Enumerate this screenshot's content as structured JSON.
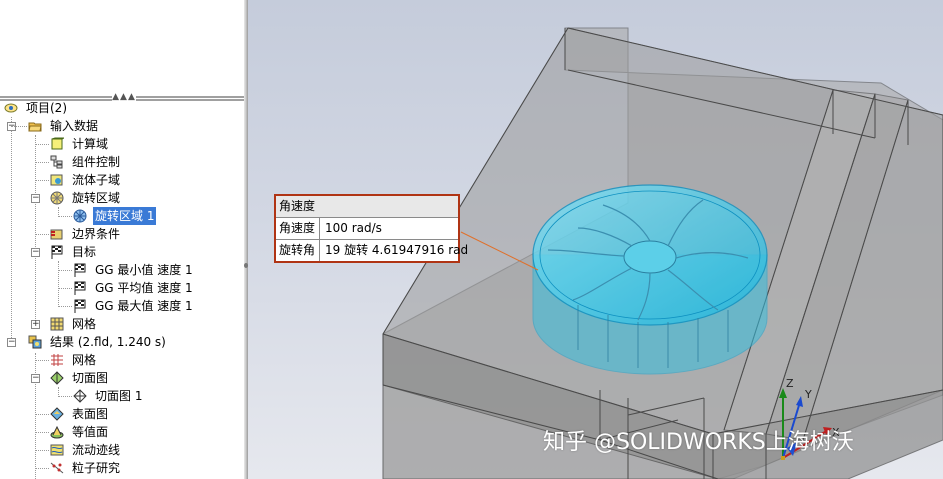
{
  "tree": {
    "items": [
      {
        "label": "项目(2)",
        "icon": "project-icon"
      },
      {
        "label": "输入数据",
        "icon": "folder-open-icon"
      },
      {
        "label": "计算域",
        "icon": "computational-domain-icon"
      },
      {
        "label": "组件控制",
        "icon": "component-control-icon"
      },
      {
        "label": "流体子域",
        "icon": "fluid-subdomain-icon"
      },
      {
        "label": "旋转区域",
        "icon": "rotating-region-icon"
      },
      {
        "label": "旋转区域 1",
        "icon": "rotating-region-icon"
      },
      {
        "label": "边界条件",
        "icon": "boundary-condition-icon"
      },
      {
        "label": "目标",
        "icon": "goals-icon"
      },
      {
        "label": "GG 最小值 速度 1",
        "icon": "goal-flag-icon"
      },
      {
        "label": "GG 平均值 速度 1",
        "icon": "goal-flag-icon"
      },
      {
        "label": "GG 最大值 速度 1",
        "icon": "goal-flag-icon"
      },
      {
        "label": "网格",
        "icon": "mesh-icon"
      },
      {
        "label": "结果 (2.fld, 1.240 s)",
        "icon": "results-icon"
      },
      {
        "label": "网格",
        "icon": "mesh-icon"
      },
      {
        "label": "切面图",
        "icon": "cut-plot-icon"
      },
      {
        "label": "切面图 1",
        "icon": "cut-plot-icon"
      },
      {
        "label": "表面图",
        "icon": "surface-plot-icon"
      },
      {
        "label": "等值面",
        "icon": "isosurface-icon"
      },
      {
        "label": "流动迹线",
        "icon": "flow-trajectory-icon"
      },
      {
        "label": "粒子研究",
        "icon": "particle-study-icon"
      }
    ],
    "expanders": [
      "−",
      "−",
      "−",
      "+",
      "−",
      "−"
    ],
    "dots": "▲▲▲"
  },
  "callout": {
    "title": "角速度",
    "rows": [
      {
        "label": "角速度",
        "value": "100 rad/s"
      },
      {
        "label": "旋转角",
        "value": "19 旋转 4.61947916 rad"
      }
    ]
  },
  "axes": {
    "z": "Z",
    "y": "Y",
    "x": "X"
  },
  "watermark": "知乎 @SOLIDWORKS上海树沃",
  "colors": {
    "selection": "#3a7ad6",
    "callout_border": "#b03414",
    "fan": "#30c8e8"
  }
}
